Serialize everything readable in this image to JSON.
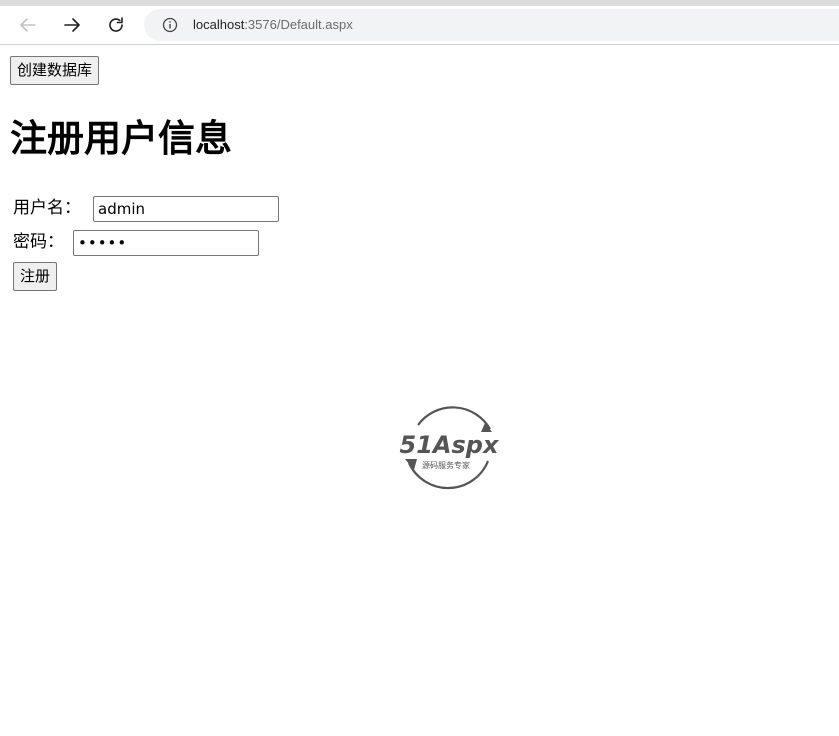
{
  "browser": {
    "url_host": "localhost",
    "url_rest": ":3576/Default.aspx",
    "back_icon": "arrow-left-icon",
    "forward_icon": "arrow-right-icon",
    "reload_icon": "reload-icon",
    "site_info_icon": "info-icon"
  },
  "page": {
    "create_db_button": "创建数据库",
    "title": "注册用户信息",
    "username_label": "用户名：",
    "username_value": "admin",
    "password_label": "密码：",
    "password_value": "admin",
    "register_button": "注册"
  },
  "watermark": {
    "logo_text": "51Aspx",
    "logo_tagline": "源码服务专家"
  },
  "colors": {
    "omnibox_bg": "#f1f3f4",
    "button_bg": "#efefef",
    "logo_gray": "#555555"
  }
}
